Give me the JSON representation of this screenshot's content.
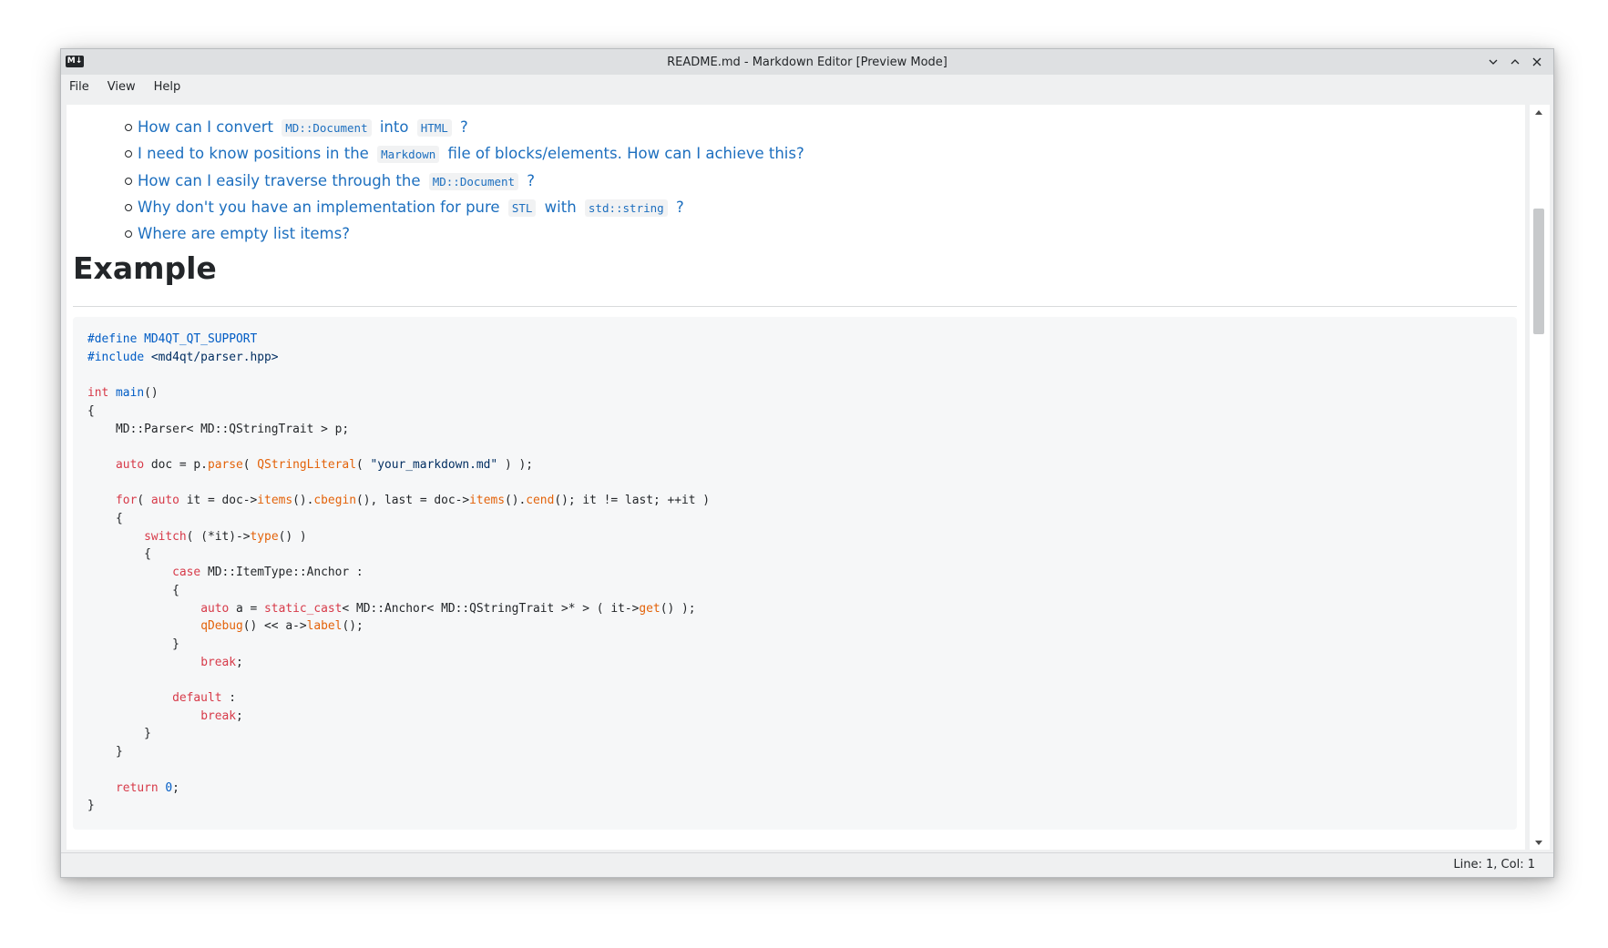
{
  "window": {
    "title": "README.md - Markdown Editor [Preview Mode]",
    "app_icon_label": "M↓"
  },
  "menu": [
    "File",
    "View",
    "Help"
  ],
  "toc_links": [
    {
      "parts": [
        {
          "t": "text",
          "v": "How can I convert "
        },
        {
          "t": "code",
          "v": "MD::Document"
        },
        {
          "t": "text",
          "v": " into "
        },
        {
          "t": "code",
          "v": "HTML"
        },
        {
          "t": "text",
          "v": " ?"
        }
      ]
    },
    {
      "parts": [
        {
          "t": "text",
          "v": "I need to know positions in the "
        },
        {
          "t": "code",
          "v": "Markdown"
        },
        {
          "t": "text",
          "v": " file of blocks/elements. How can I achieve this?"
        }
      ]
    },
    {
      "parts": [
        {
          "t": "text",
          "v": "How can I easily traverse through the "
        },
        {
          "t": "code",
          "v": "MD::Document"
        },
        {
          "t": "text",
          "v": " ?"
        }
      ]
    },
    {
      "parts": [
        {
          "t": "text",
          "v": "Why don't you have an implementation for pure "
        },
        {
          "t": "code",
          "v": "STL"
        },
        {
          "t": "text",
          "v": " with "
        },
        {
          "t": "code",
          "v": "std::string"
        },
        {
          "t": "text",
          "v": " ?"
        }
      ]
    },
    {
      "parts": [
        {
          "t": "text",
          "v": "Where are empty list items?"
        }
      ]
    }
  ],
  "heading": "Example",
  "code_lines": [
    [
      [
        "pp",
        "#define "
      ],
      [
        "nm",
        "MD4QT_QT_SUPPORT"
      ]
    ],
    [
      [
        "pp",
        "#include "
      ],
      [
        "st",
        "<md4qt/parser.hpp>"
      ]
    ],
    [],
    [
      [
        "kw",
        "int "
      ],
      [
        "nm",
        "main"
      ],
      [
        "p",
        "()"
      ]
    ],
    [
      [
        "p",
        "{"
      ]
    ],
    [
      [
        "p",
        "    MD::Parser< MD::QStringTrait > p;"
      ]
    ],
    [],
    [
      [
        "p",
        "    "
      ],
      [
        "kw",
        "auto "
      ],
      [
        "p",
        "doc = p."
      ],
      [
        "fn",
        "parse"
      ],
      [
        "p",
        "( "
      ],
      [
        "fn",
        "QStringLiteral"
      ],
      [
        "p",
        "( "
      ],
      [
        "st",
        "\"your_markdown.md\""
      ],
      [
        "p",
        " ) );"
      ]
    ],
    [],
    [
      [
        "p",
        "    "
      ],
      [
        "kw",
        "for"
      ],
      [
        "p",
        "( "
      ],
      [
        "kw",
        "auto "
      ],
      [
        "p",
        "it = doc->"
      ],
      [
        "fn",
        "items"
      ],
      [
        "p",
        "()."
      ],
      [
        "fn",
        "cbegin"
      ],
      [
        "p",
        "(), last = doc->"
      ],
      [
        "fn",
        "items"
      ],
      [
        "p",
        "()."
      ],
      [
        "fn",
        "cend"
      ],
      [
        "p",
        "(); it != last; ++it )"
      ]
    ],
    [
      [
        "p",
        "    {"
      ]
    ],
    [
      [
        "p",
        "        "
      ],
      [
        "kw",
        "switch"
      ],
      [
        "p",
        "( (*it)->"
      ],
      [
        "fn",
        "type"
      ],
      [
        "p",
        "() )"
      ]
    ],
    [
      [
        "p",
        "        {"
      ]
    ],
    [
      [
        "p",
        "            "
      ],
      [
        "kw",
        "case "
      ],
      [
        "p",
        "MD::ItemType::Anchor :"
      ]
    ],
    [
      [
        "p",
        "            {"
      ]
    ],
    [
      [
        "p",
        "                "
      ],
      [
        "kw",
        "auto "
      ],
      [
        "p",
        "a = "
      ],
      [
        "kw",
        "static_cast"
      ],
      [
        "p",
        "< MD::Anchor< MD::QStringTrait >* > ( it->"
      ],
      [
        "fn",
        "get"
      ],
      [
        "p",
        "() );"
      ]
    ],
    [
      [
        "p",
        "                "
      ],
      [
        "fn",
        "qDebug"
      ],
      [
        "p",
        "() << a->"
      ],
      [
        "fn",
        "label"
      ],
      [
        "p",
        "();"
      ]
    ],
    [
      [
        "p",
        "            }"
      ]
    ],
    [
      [
        "p",
        "                "
      ],
      [
        "kw",
        "break"
      ],
      [
        "p",
        ";"
      ]
    ],
    [],
    [
      [
        "p",
        "            "
      ],
      [
        "kw",
        "default "
      ],
      [
        "p",
        ":"
      ]
    ],
    [
      [
        "p",
        "                "
      ],
      [
        "kw",
        "break"
      ],
      [
        "p",
        ";"
      ]
    ],
    [
      [
        "p",
        "        }"
      ]
    ],
    [
      [
        "p",
        "    }"
      ]
    ],
    [],
    [
      [
        "p",
        "    "
      ],
      [
        "kw",
        "return "
      ],
      [
        "nm",
        "0"
      ],
      [
        "p",
        ";"
      ]
    ],
    [
      [
        "p",
        "}"
      ]
    ]
  ],
  "status": {
    "position": "Line: 1, Col: 1"
  },
  "colors": {
    "link": "#1d6fbf",
    "keyword": "#d73a49",
    "function": "#e36209",
    "string": "#032f62",
    "number": "#005cc5"
  }
}
